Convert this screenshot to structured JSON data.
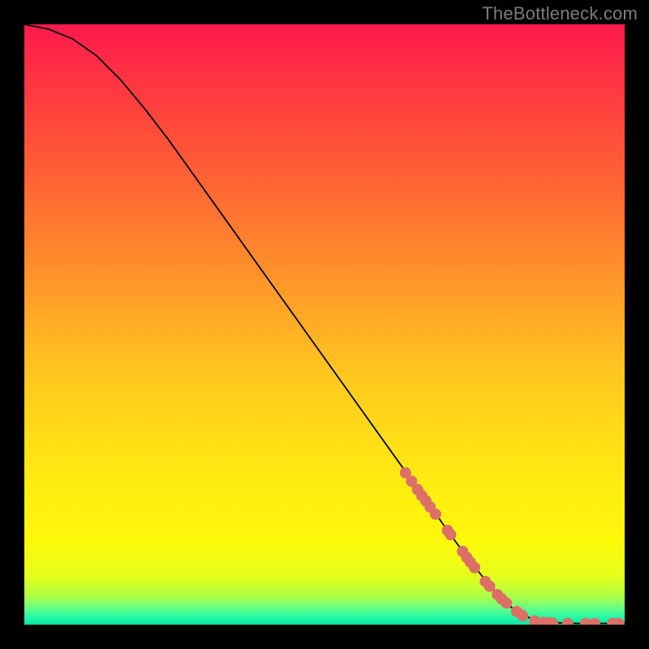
{
  "attribution": "TheBottleneck.com",
  "colors": {
    "frame": "#000000",
    "gradient_stops": [
      {
        "offset": 0.0,
        "color": "#ff1a4c"
      },
      {
        "offset": 0.2,
        "color": "#ff5238"
      },
      {
        "offset": 0.4,
        "color": "#ff8d2b"
      },
      {
        "offset": 0.58,
        "color": "#ffc61f"
      },
      {
        "offset": 0.74,
        "color": "#ffe812"
      },
      {
        "offset": 0.86,
        "color": "#fff90a"
      },
      {
        "offset": 0.92,
        "color": "#e4ff1a"
      },
      {
        "offset": 0.955,
        "color": "#a9ff4a"
      },
      {
        "offset": 0.975,
        "color": "#5cff8e"
      },
      {
        "offset": 0.99,
        "color": "#1cf7a8"
      },
      {
        "offset": 1.0,
        "color": "#0be3a2"
      }
    ],
    "line": "#000000",
    "marker": "#dd6f66"
  },
  "chart_data": {
    "type": "line",
    "title": "",
    "xlabel": "",
    "ylabel": "",
    "xlim": [
      0,
      100
    ],
    "ylim": [
      0,
      100
    ],
    "grid": false,
    "legend": false,
    "series": [
      {
        "name": "curve",
        "x": [
          0,
          4,
          8,
          12,
          16,
          20,
          24,
          28,
          32,
          36,
          40,
          44,
          48,
          52,
          56,
          60,
          64,
          68,
          72,
          76,
          80,
          82,
          84,
          86,
          88,
          90,
          92,
          94,
          96,
          98,
          100
        ],
        "y": [
          100.0,
          99.2,
          97.6,
          94.8,
          90.8,
          86.0,
          80.8,
          75.2,
          69.6,
          64.0,
          58.4,
          52.8,
          47.2,
          41.6,
          36.0,
          30.4,
          24.8,
          19.2,
          13.6,
          8.4,
          3.8,
          2.2,
          1.2,
          0.6,
          0.35,
          0.25,
          0.2,
          0.2,
          0.2,
          0.2,
          0.2
        ]
      }
    ],
    "markers": {
      "name": "data-points",
      "note": "Scatter markers overlaid on the curve (lower-right region only).",
      "x": [
        63.5,
        64.5,
        65.5,
        66.2,
        66.9,
        67.6,
        68.5,
        70.5,
        71.0,
        73.0,
        73.7,
        74.3,
        75.0,
        76.8,
        77.5,
        78.8,
        79.5,
        80.3,
        82.0,
        83.0,
        85.0,
        86.5,
        87.3,
        88.0,
        90.5,
        93.5,
        95.0,
        98.0,
        99.0
      ],
      "y": [
        25.3,
        23.9,
        22.5,
        21.5,
        20.6,
        19.6,
        18.4,
        15.7,
        15.0,
        12.2,
        11.2,
        10.4,
        9.5,
        7.2,
        6.4,
        5.0,
        4.3,
        3.6,
        2.2,
        1.5,
        0.6,
        0.35,
        0.3,
        0.25,
        0.2,
        0.2,
        0.2,
        0.2,
        0.2
      ]
    }
  }
}
